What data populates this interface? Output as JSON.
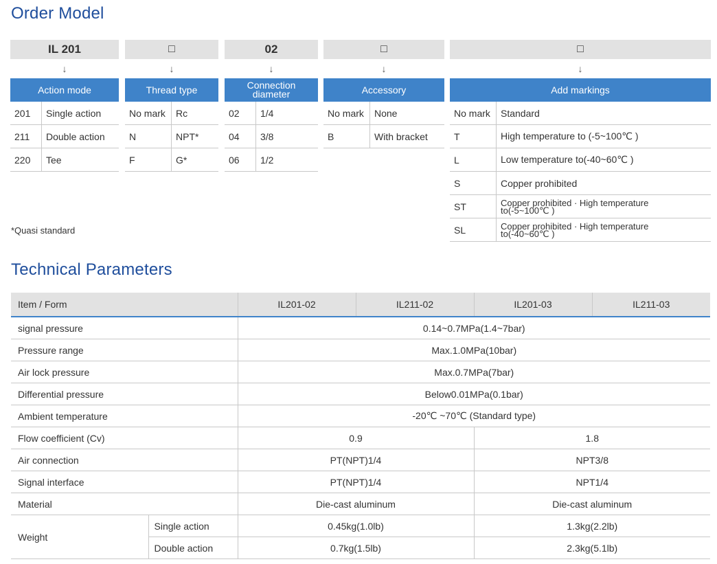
{
  "order_model": {
    "title": "Order Model",
    "columns": [
      {
        "code": "IL 201",
        "header": "Action mode",
        "rows": [
          {
            "k": "201",
            "v": "Single action"
          },
          {
            "k": "211",
            "v": "Double action"
          },
          {
            "k": "220",
            "v": "Tee"
          }
        ]
      },
      {
        "code": "□",
        "header": "Thread type",
        "rows": [
          {
            "k": "No mark",
            "v": "Rc"
          },
          {
            "k": "N",
            "v": "NPT*"
          },
          {
            "k": "F",
            "v": "G*"
          }
        ]
      },
      {
        "code": "02",
        "header": "Connection diameter",
        "rows": [
          {
            "k": "02",
            "v": "1/4"
          },
          {
            "k": "04",
            "v": "3/8"
          },
          {
            "k": "06",
            "v": "1/2"
          }
        ]
      },
      {
        "code": "□",
        "header": "Accessory",
        "rows": [
          {
            "k": "No mark",
            "v": "None"
          },
          {
            "k": "B",
            "v": "With bracket"
          }
        ]
      },
      {
        "code": "□",
        "header": "Add markings",
        "rows": [
          {
            "k": "No mark",
            "v": "Standard"
          },
          {
            "k": "T",
            "v": "High temperature to (-5~100℃ )"
          },
          {
            "k": "L",
            "v": "Low temperature to(-40~60℃ )"
          },
          {
            "k": "S",
            "v": "Copper prohibited"
          },
          {
            "k": "ST",
            "v": "Copper prohibited · High temperature to(-5~100℃ )"
          },
          {
            "k": "SL",
            "v": "Copper prohibited · High temperature to(-40~60℃ )"
          }
        ]
      }
    ],
    "arrow": "↓",
    "footnote": "*Quasi standard"
  },
  "technical": {
    "title": "Technical Parameters",
    "header": [
      "Item / Form",
      "IL201-02",
      "IL211-02",
      "IL201-03",
      "IL211-03"
    ],
    "rows": {
      "signal_pressure": {
        "label": "signal pressure",
        "value": "0.14~0.7MPa(1.4~7bar)"
      },
      "pressure_range": {
        "label": "Pressure range",
        "value": "Max.1.0MPa(10bar)"
      },
      "air_lock": {
        "label": "Air lock pressure",
        "value": "Max.0.7MPa(7bar)"
      },
      "differential": {
        "label": "Differential pressure",
        "value": "Below0.01MPa(0.1bar)"
      },
      "ambient": {
        "label": "Ambient temperature",
        "value": "-20℃ ~70℃ (Standard type)"
      },
      "flow": {
        "label": "Flow coefficient (Cv)",
        "a": "0.9",
        "b": "1.8"
      },
      "air_conn": {
        "label": "Air connection",
        "a": "PT(NPT)1/4",
        "b": "NPT3/8"
      },
      "signal_if": {
        "label": "Signal interface",
        "a": "PT(NPT)1/4",
        "b": "NPT1/4"
      },
      "material": {
        "label": "Material",
        "a": "Die-cast aluminum",
        "b": "Die-cast aluminum"
      },
      "weight": {
        "label": "Weight",
        "single": {
          "label": "Single action",
          "a": "0.45kg(1.0lb)",
          "b": "1.3kg(2.2lb)"
        },
        "double": {
          "label": "Double action",
          "a": "0.7kg(1.5lb)",
          "b": "2.3kg(5.1lb)"
        }
      }
    }
  }
}
